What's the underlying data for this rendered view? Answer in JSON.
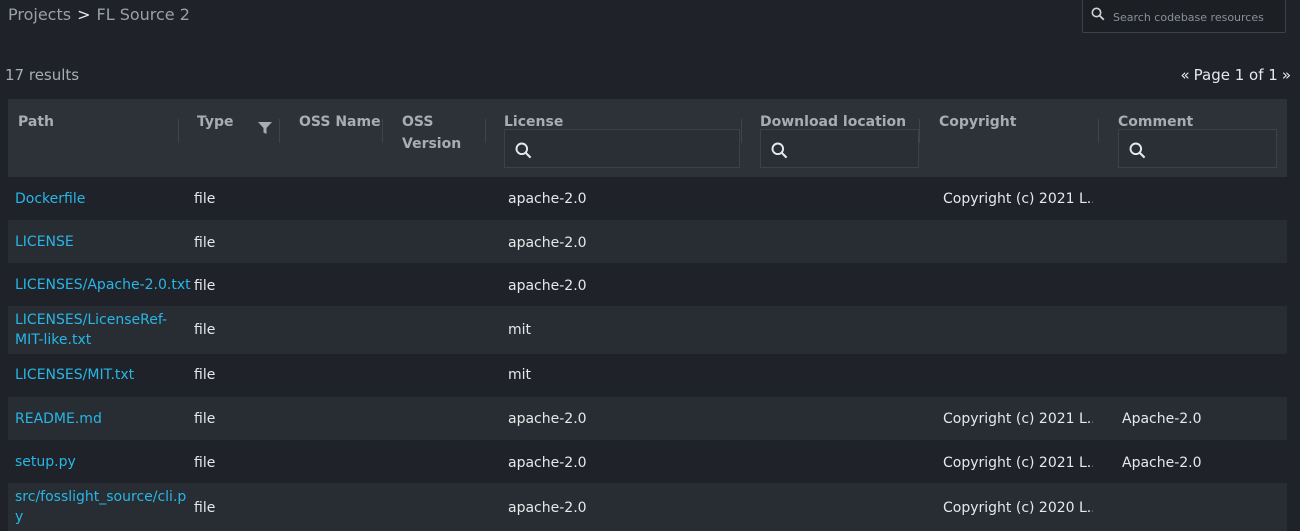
{
  "breadcrumb": {
    "root": "Projects",
    "separator": ">",
    "current": "FL Source 2"
  },
  "search": {
    "placeholder": "Search codebase resources"
  },
  "results_count": "17 results",
  "pager": {
    "prev": "«",
    "label": "Page 1 of 1",
    "next": "»"
  },
  "columns": {
    "path": "Path",
    "type": "Type",
    "oss_name": "OSS Name",
    "oss_version_line1": "OSS",
    "oss_version_line2": "Version",
    "license": "License",
    "download_location": "Download location",
    "copyright": "Copyright",
    "comment": "Comment"
  },
  "rows": [
    {
      "path_lines": [
        "Dockerfile"
      ],
      "type": "file",
      "license": "apache-2.0",
      "copyright": "Copyright (c) 2021 L...",
      "comment": ""
    },
    {
      "path_lines": [
        "LICENSE"
      ],
      "type": "file",
      "license": "apache-2.0",
      "copyright": "",
      "comment": ""
    },
    {
      "path_lines": [
        "LICENSES/Apache-2.0.txt"
      ],
      "type": "file",
      "license": "apache-2.0",
      "copyright": "",
      "comment": ""
    },
    {
      "path_lines": [
        "LICENSES/LicenseRef-",
        "MIT-like.txt"
      ],
      "type": "file",
      "license": "mit",
      "copyright": "",
      "comment": ""
    },
    {
      "path_lines": [
        "LICENSES/MIT.txt"
      ],
      "type": "file",
      "license": "mit",
      "copyright": "",
      "comment": ""
    },
    {
      "path_lines": [
        "README.md"
      ],
      "type": "file",
      "license": "apache-2.0",
      "copyright": "Copyright (c) 2021 L...",
      "comment": "Apache-2.0"
    },
    {
      "path_lines": [
        "setup.py"
      ],
      "type": "file",
      "license": "apache-2.0",
      "copyright": "Copyright (c) 2021 L...",
      "comment": "Apache-2.0"
    },
    {
      "path_lines": [
        "src/fosslight_source/cli.p",
        "y"
      ],
      "type": "file",
      "license": "apache-2.0",
      "copyright": "Copyright (c) 2020 L...",
      "comment": ""
    }
  ],
  "colors": {
    "background": "#1f2329",
    "header_bg": "#2d3238",
    "alt_row_bg": "#282d33",
    "link": "#28b6e6",
    "text": "#e6e8ea",
    "muted": "#a7adb3"
  }
}
